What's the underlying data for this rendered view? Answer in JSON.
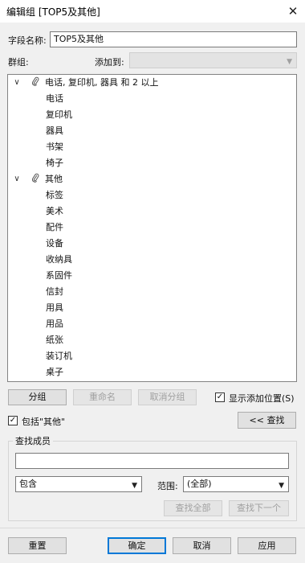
{
  "window": {
    "title": "编辑组 [TOP5及其他]",
    "close_glyph": "✕"
  },
  "form": {
    "field_name_label": "字段名称:",
    "field_name_value": "TOP5及其他",
    "group_label": "群组:",
    "add_to_label": "添加到:",
    "add_to_value": ""
  },
  "tree": {
    "groups": [
      {
        "label": "电话, 复印机, 器具 和 2 以上",
        "expanded": true,
        "children": [
          "电话",
          "复印机",
          "器具",
          "书架",
          "椅子"
        ]
      },
      {
        "label": "其他",
        "expanded": true,
        "children": [
          "标签",
          "美术",
          "配件",
          "设备",
          "收纳具",
          "系固件",
          "信封",
          "用具",
          "用品",
          "纸张",
          "装订机",
          "桌子"
        ]
      }
    ]
  },
  "buttons": {
    "group": "分组",
    "rename": "重命名",
    "ungroup": "取消分组",
    "find_toggle": "<< 查找",
    "find_all": "查找全部",
    "find_next": "查找下一个",
    "reset": "重置",
    "ok": "确定",
    "cancel": "取消",
    "apply": "应用"
  },
  "options": {
    "show_add_location": {
      "label": "显示添加位置(S)",
      "checked": true
    },
    "include_other": {
      "label": "包括\"其他\"",
      "checked": true
    }
  },
  "find": {
    "section_title": "查找成员",
    "query_value": "",
    "match_mode_value": "包含",
    "scope_label": "范围:",
    "scope_value": "(全部)"
  },
  "icons": {
    "expanded": "chevron-down-icon",
    "group": "paperclip-icon",
    "check": "✓",
    "dropdown": "▼"
  }
}
